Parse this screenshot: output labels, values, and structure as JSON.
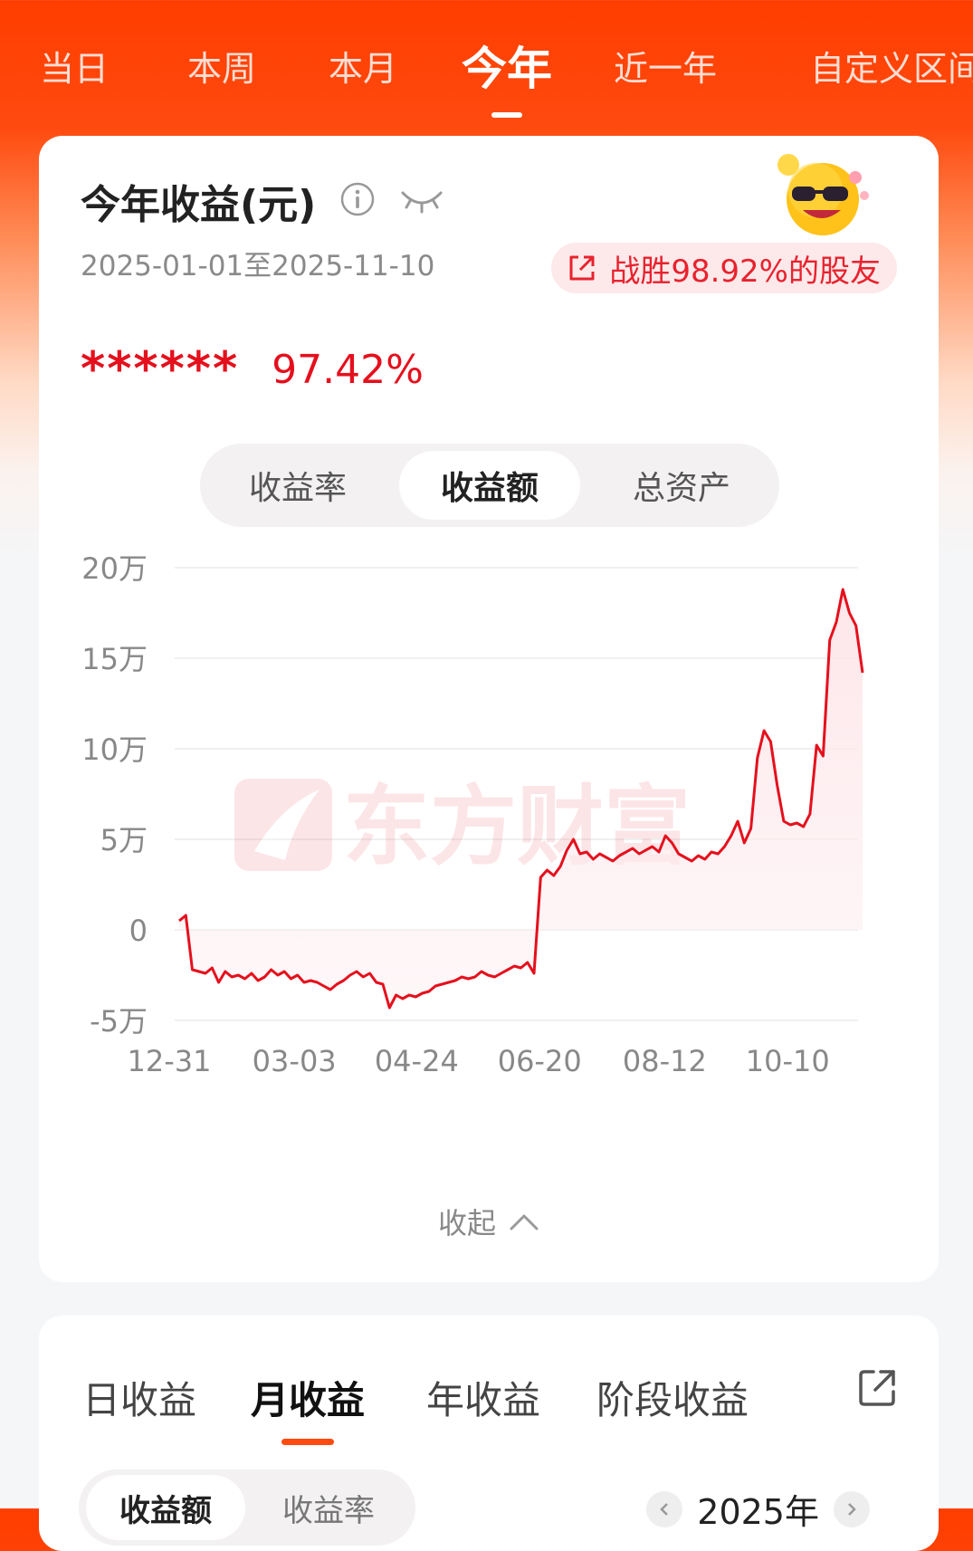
{
  "top_tabs": [
    {
      "label": "当日"
    },
    {
      "label": "本周"
    },
    {
      "label": "本月"
    },
    {
      "label": "今年",
      "active": true
    },
    {
      "label": "近一年"
    },
    {
      "label": "自定义区间"
    }
  ],
  "summary": {
    "title": "今年收益(元)",
    "date_range": "2025-01-01至2025-11-10",
    "beat_text": "战胜98.92%的股友",
    "masked_amount": "******",
    "return_rate": "97.42%"
  },
  "view_tabs": [
    {
      "label": "收益率"
    },
    {
      "label": "收益额",
      "active": true
    },
    {
      "label": "总资产"
    }
  ],
  "watermark": "东方财富",
  "collapse_label": "收起",
  "bottom_tabs": [
    {
      "label": "日收益"
    },
    {
      "label": "月收益",
      "active": true
    },
    {
      "label": "年收益"
    },
    {
      "label": "阶段收益"
    }
  ],
  "sub_tabs": [
    {
      "label": "收益额",
      "active": true
    },
    {
      "label": "收益率"
    }
  ],
  "year_selector": "2025年",
  "colors": {
    "accent": "#ff4a10",
    "line": "#e5101d",
    "fill": "#fde7ea"
  },
  "chart_data": {
    "type": "line",
    "y_tick_labels": [
      "20万",
      "15万",
      "10万",
      "5万",
      "0",
      "-5万"
    ],
    "y_ticks": [
      200000,
      150000,
      100000,
      50000,
      0,
      -50000
    ],
    "ylim": [
      -50000,
      200000
    ],
    "x_tick_labels": [
      "12-31",
      "03-03",
      "04-24",
      "06-20",
      "08-12",
      "10-10"
    ],
    "x_tick_positions": [
      0,
      0.183,
      0.362,
      0.542,
      0.725,
      0.905
    ],
    "series": [
      {
        "values": [
          5000,
          8000,
          -22000,
          -23000,
          -24000,
          -21000,
          -29000,
          -23000,
          -26000,
          -25000,
          -27000,
          -24000,
          -28000,
          -26000,
          -22000,
          -25000,
          -23000,
          -27000,
          -25000,
          -29000,
          -28000,
          -29000,
          -31000,
          -33000,
          -30000,
          -28000,
          -25000,
          -23000,
          -26000,
          -24000,
          -29000,
          -30000,
          -43000,
          -36000,
          -38000,
          -36000,
          -37000,
          -35000,
          -34000,
          -31000,
          -30000,
          -29000,
          -28000,
          -26000,
          -27000,
          -26000,
          -23000,
          -25000,
          -26000,
          -24000,
          -22000,
          -20000,
          -21000,
          -18000,
          -24000,
          29000,
          33000,
          30000,
          35000,
          44000,
          50000,
          42000,
          43000,
          39000,
          42000,
          40000,
          38000,
          41000,
          43000,
          45000,
          42000,
          44000,
          46000,
          43000,
          52000,
          48000,
          42000,
          40000,
          38000,
          41000,
          39000,
          43000,
          42000,
          46000,
          52000,
          60000,
          48000,
          56000,
          95000,
          110000,
          104000,
          80000,
          60000,
          58000,
          59000,
          57000,
          64000,
          102000,
          96000,
          160000,
          170000,
          188000,
          175000,
          168000,
          142000
        ]
      }
    ]
  }
}
